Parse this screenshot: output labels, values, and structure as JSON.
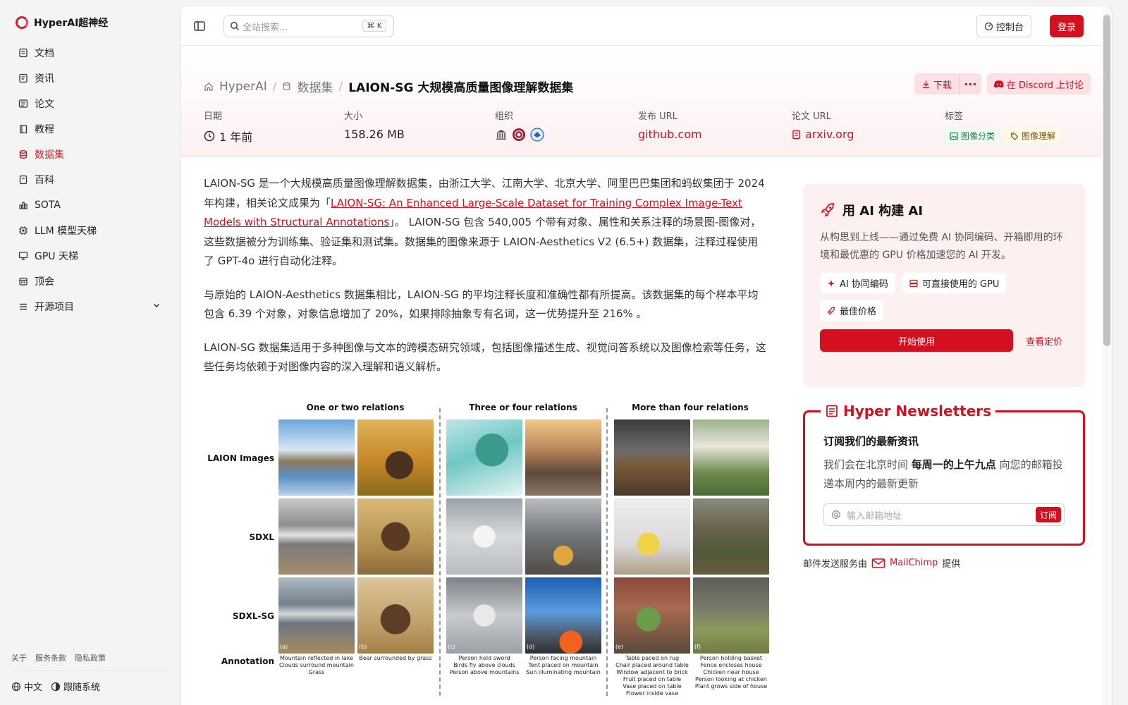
{
  "brand": {
    "name": "HyperAI超神经"
  },
  "sidebar": {
    "items": [
      {
        "label": "文档",
        "icon": "doc-icon",
        "active": false
      },
      {
        "label": "资讯",
        "icon": "news-icon",
        "active": false
      },
      {
        "label": "论文",
        "icon": "paper-icon",
        "active": false
      },
      {
        "label": "教程",
        "icon": "book-icon",
        "active": false
      },
      {
        "label": "数据集",
        "icon": "database-icon",
        "active": true
      },
      {
        "label": "百科",
        "icon": "wiki-icon",
        "active": false
      },
      {
        "label": "SOTA",
        "icon": "chart-icon",
        "active": false
      },
      {
        "label": "LLM 模型天梯",
        "icon": "chip-icon",
        "active": false
      },
      {
        "label": "GPU 天梯",
        "icon": "monitor-icon",
        "active": false
      },
      {
        "label": "顶会",
        "icon": "calendar-icon",
        "active": false
      },
      {
        "label": "开源项目",
        "icon": "list-icon",
        "active": false
      }
    ],
    "footer_links": [
      "关于",
      "服务条款",
      "隐私政策"
    ],
    "language": "中文",
    "theme": "跟随系统"
  },
  "topbar": {
    "search_placeholder": "全站搜索...",
    "search_shortcut": "K",
    "console_label": "控制台",
    "login_label": "登录"
  },
  "breadcrumb": {
    "root": "HyperAI",
    "section": "数据集",
    "current": "LAION-SG 大规模高质量图像理解数据集"
  },
  "actions": {
    "download": "下载",
    "discord": "在 Discord 上讨论"
  },
  "meta": {
    "date_label": "日期",
    "date_value": "1 年前",
    "size_label": "大小",
    "size_value": "158.26 MB",
    "org_label": "组织",
    "release_label": "发布 URL",
    "release_value": "github.com",
    "paper_label": "论文 URL",
    "paper_value": "arxiv.org",
    "tags_label": "标签",
    "tags": [
      "图像分类",
      "图像理解"
    ]
  },
  "article": {
    "p1_a": "LAION-SG 是一个大规模高质量图像理解数据集，由浙江大学、江南大学、北京大学、阿里巴巴集团和蚂蚁集团于 2024 年构建，相关论文成果为「",
    "p1_link": "LAION-SG: An Enhanced Large-Scale Dataset for Training Complex Image-Text Models with Structural Annotations",
    "p1_b": "」。 LAION-SG 包含 540,005 个带有对象、属性和关系注释的场景图-图像对，这些数据被分为训练集、验证集和测试集。数据集的图像来源于 LAION-Aesthetics V2 (6.5+) 数据集，注释过程使用了 GPT-4o 进行自动化注释。",
    "p2": "与原始的 LAION-Aesthetics 数据集相比，LAION-SG 的平均注释长度和准确性都有所提高。该数据集的每个样本平均包含 6.39 个对象，对象信息增加了 20%，如果排除抽象专有名词，这一优势提升至 216% 。",
    "p3": "LAION-SG 数据集适用于多种图像与文本的跨模态研究领域，包括图像描述生成、视觉问答系统以及图像检索等任务，这些任务均依赖于对图像内容的深入理解和语义解析。"
  },
  "figure": {
    "columns": [
      "One or two relations",
      "Three or four relations",
      "More than four relations"
    ],
    "rows": [
      "LAION Images",
      "SDXL",
      "SDXL-SG",
      "Annotation"
    ],
    "labels": [
      "(a)",
      "(b)",
      "(c)",
      "(d)",
      "(e)",
      "(f)"
    ],
    "annotations": [
      [
        "Mountain reflected in lake",
        "Clouds surround mountain",
        "Grass"
      ],
      [
        "Bear surrounded by grass"
      ],
      [
        "Person hold sword",
        "Birds fly above clouds",
        "Person above mountains"
      ],
      [
        "Person facing mountain",
        "Tent placed on mountain",
        "Sun illuminating mountain"
      ],
      [
        "Table paced on rug",
        "Chair placed around table",
        "Window adjacent to brick",
        "Fruit placed on table",
        "Vase placed on table",
        "Flower inside vase"
      ],
      [
        "Person holding basket",
        "Fence encloses house",
        "Chicken near house",
        "Person looking at chicken",
        "Plant grows side of house"
      ]
    ]
  },
  "ai_card": {
    "title": "用 AI 构建 AI",
    "desc": "从构思到上线——通过免费 AI 协同编码、开箱即用的环境和最优惠的 GPU 价格加速您的 AI 开发。",
    "chips": [
      "AI 协同编码",
      "可直接使用的 GPU",
      "最佳价格"
    ],
    "start": "开始使用",
    "pricing": "查看定价"
  },
  "newsletter": {
    "title": "Hyper Newsletters",
    "subtitle": "订阅我们的最新资讯",
    "desc_a": "我们会在北京时间 ",
    "desc_bold": "每周一的上午九点",
    "desc_b": " 向您的邮箱投递本周内的最新更新",
    "email_placeholder": "输入邮箱地址",
    "subscribe": "订阅",
    "footer_a": "邮件发送服务由",
    "footer_brand": "MailChimp",
    "footer_b": "提供"
  },
  "colors": {
    "accent": "#d2101f",
    "hero_bg": "#fdf0f1"
  }
}
